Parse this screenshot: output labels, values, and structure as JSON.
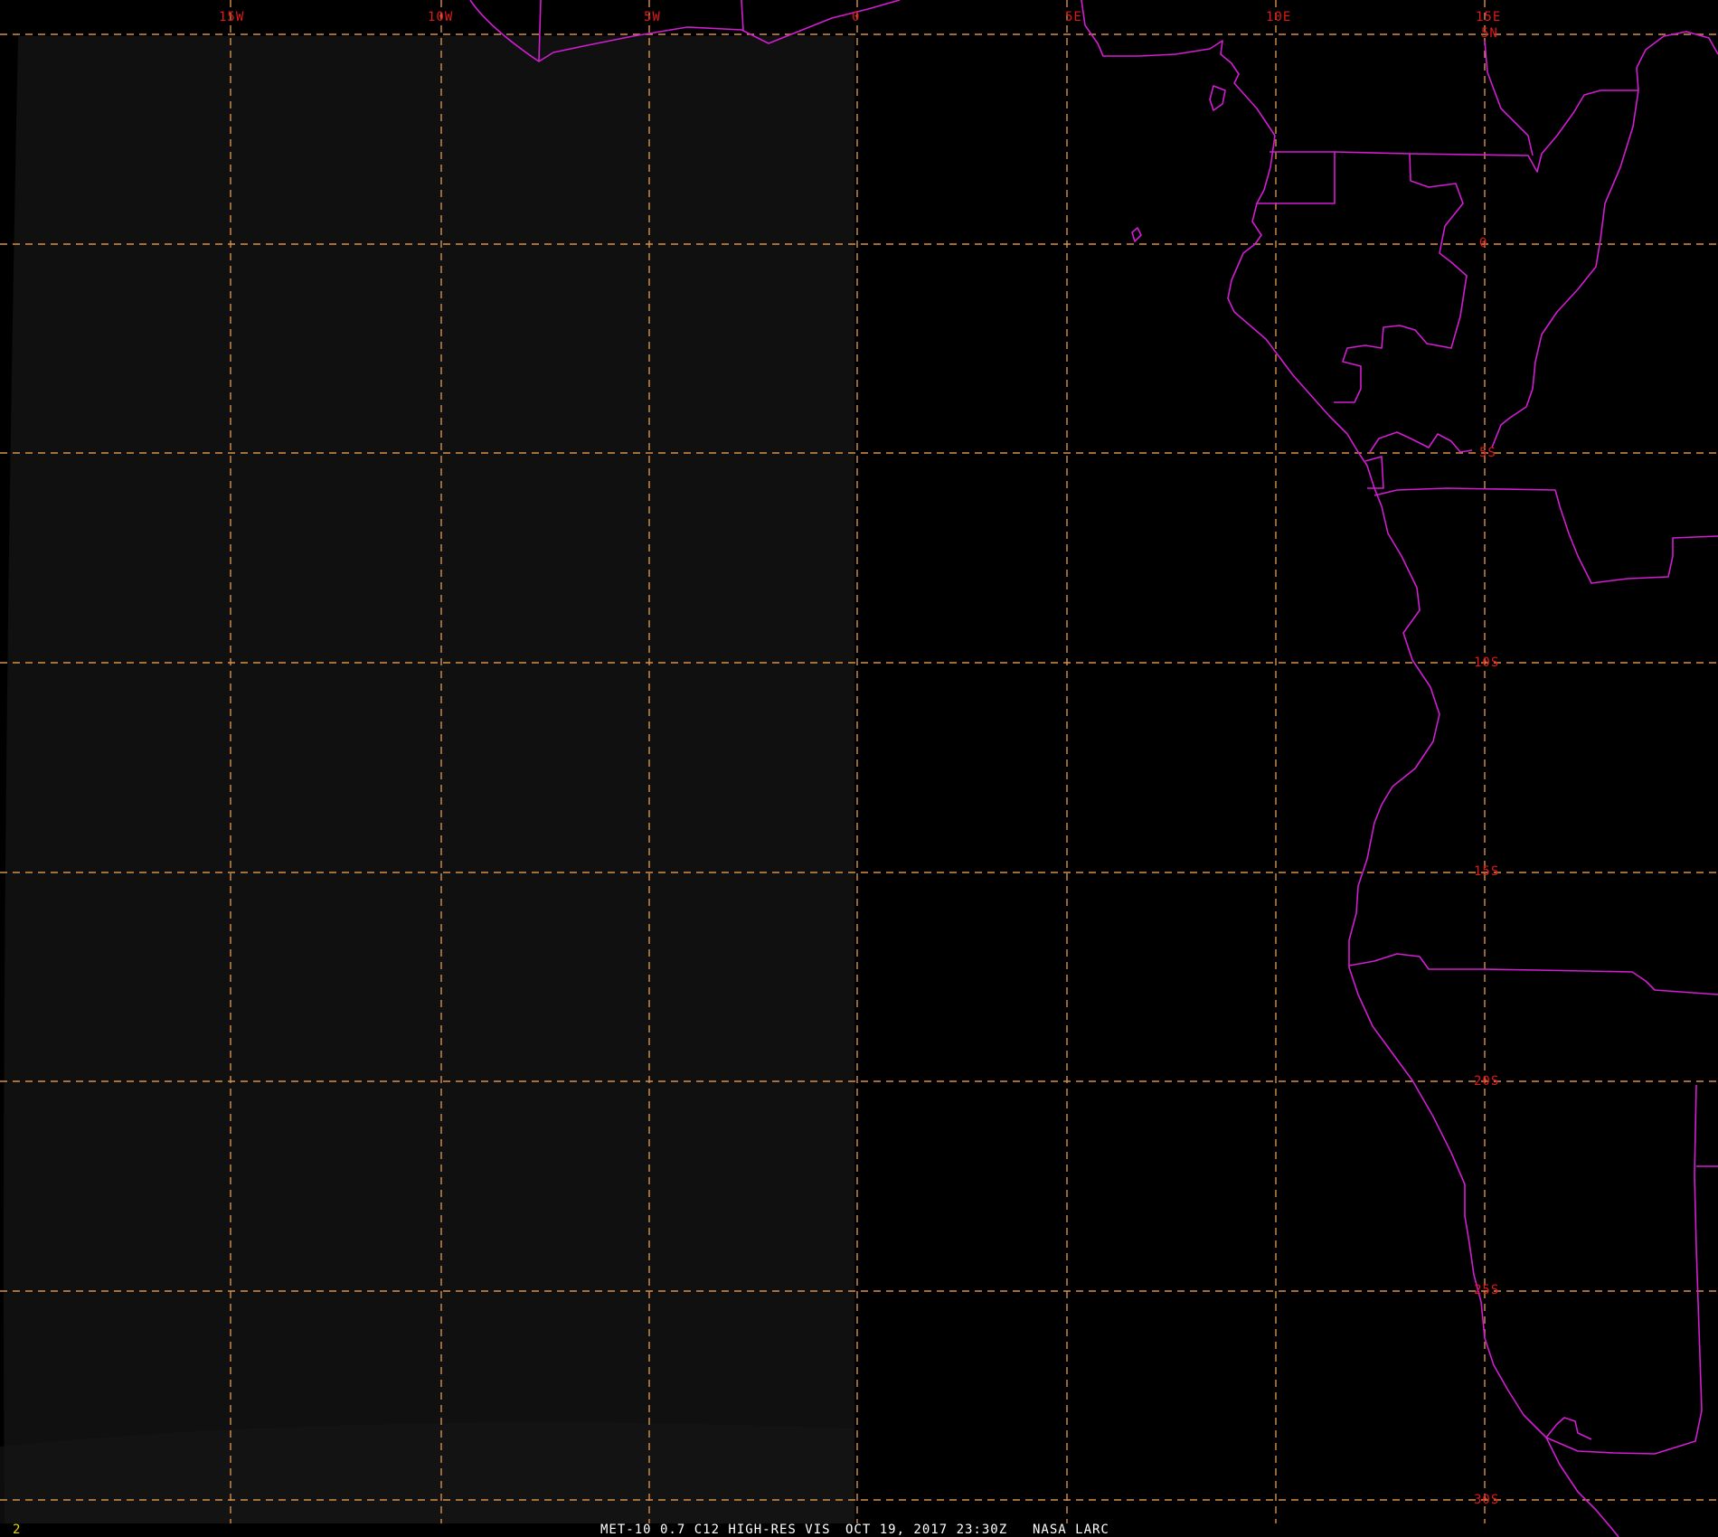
{
  "colors": {
    "background": "#000000",
    "graticule": "#d8904a",
    "coastline": "#d21dd2",
    "grid_label": "#e01818",
    "caption": "#ffffff",
    "frame_number": "#e8d800"
  },
  "longitude_labels": [
    "15W",
    "10W",
    "5W",
    "0",
    "5E",
    "10E",
    "15E"
  ],
  "latitude_labels": [
    "5N",
    "0",
    "5S",
    "10S",
    "15S",
    "20S",
    "25S",
    "30S"
  ],
  "caption": {
    "frame_number": "2",
    "sensor": "MET-10 0.7 C12 HIGH-RES VIS",
    "datetime": "OCT 19, 2017 23:30Z",
    "source": "NASA LARC"
  }
}
